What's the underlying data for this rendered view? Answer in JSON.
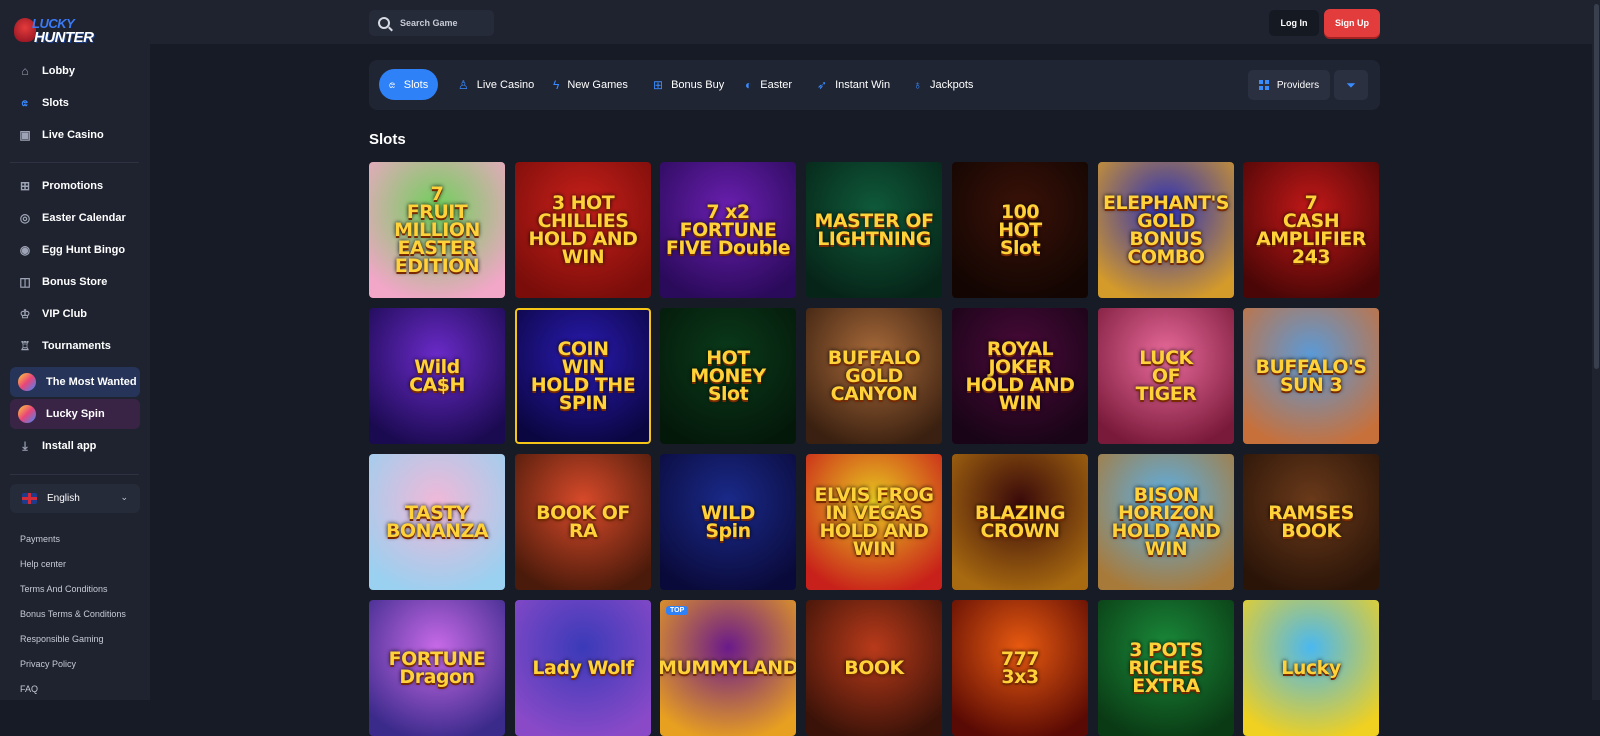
{
  "brand": {
    "line1": "LUCKY",
    "line2": "HUNTER"
  },
  "sidebar": {
    "main": [
      {
        "label": "Lobby",
        "icon": "home-icon"
      },
      {
        "label": "Slots",
        "icon": "cherries-icon"
      },
      {
        "label": "Live Casino",
        "icon": "cards-icon"
      }
    ],
    "secondary": [
      {
        "label": "Promotions",
        "icon": "gift-icon"
      },
      {
        "label": "Easter Calendar",
        "icon": "calendar-icon"
      },
      {
        "label": "Egg Hunt Bingo",
        "icon": "bingo-icon"
      },
      {
        "label": "Bonus Store",
        "icon": "bag-icon"
      },
      {
        "label": "VIP Club",
        "icon": "crown-icon"
      },
      {
        "label": "Tournaments",
        "icon": "trophy-icon"
      }
    ],
    "featured": [
      {
        "label": "The Most Wanted"
      },
      {
        "label": "Lucky Spin"
      }
    ],
    "install": "Install app",
    "language": "English",
    "footer_links": [
      "Payments",
      "Help center",
      "Terms And Conditions",
      "Bonus Terms & Conditions",
      "Responsible Gaming",
      "Privacy Policy",
      "FAQ"
    ]
  },
  "header": {
    "search_placeholder": "Search Game",
    "login": "Log In",
    "signup": "Sign Up"
  },
  "categories": [
    {
      "label": "Slots",
      "icon": "cherries-icon"
    },
    {
      "label": "Live Casino",
      "icon": "dealer-icon"
    },
    {
      "label": "New Games",
      "icon": "bolt-icon"
    },
    {
      "label": "Bonus Buy",
      "icon": "gift-icon"
    },
    {
      "label": "Easter",
      "icon": "egg-icon"
    },
    {
      "label": "Instant Win",
      "icon": "rocket-icon"
    },
    {
      "label": "Jackpots",
      "icon": "moneybag-icon"
    }
  ],
  "providers_label": "Providers",
  "section_title": "Slots",
  "games": [
    {
      "title": "7\nFRUIT\nMILLION\nEASTER EDITION"
    },
    {
      "title": "3 HOT\nCHILLIES\nHOLD AND WIN"
    },
    {
      "title": "7 x2\nFORTUNE\nFIVE Double"
    },
    {
      "title": "MASTER OF\nLIGHTNING"
    },
    {
      "title": "100\nHOT\nSlot"
    },
    {
      "title": "ELEPHANT'S\nGOLD\nBONUS COMBO"
    },
    {
      "title": "7\nCASH\nAMPLIFIER 243"
    },
    {
      "title": "Wild\nCA$H"
    },
    {
      "title": "COIN\nWIN\nHOLD THE SPIN",
      "selected": true
    },
    {
      "title": "HOT\nMONEY\nSlot"
    },
    {
      "title": "BUFFALO\nGOLD CANYON"
    },
    {
      "title": "ROYAL\nJOKER\nHOLD AND WIN"
    },
    {
      "title": "LUCK\nOF\nTIGER"
    },
    {
      "title": "BUFFALO'S\nSUN 3"
    },
    {
      "title": "TASTY\nBONANZA"
    },
    {
      "title": "BOOK OF RA"
    },
    {
      "title": "WILD\nSpin"
    },
    {
      "title": "ELVIS FROG\nIN VEGAS\nHOLD AND WIN"
    },
    {
      "title": "BLAZING\nCROWN"
    },
    {
      "title": "BISON HORIZON\nHOLD AND WIN"
    },
    {
      "title": "RAMSES\nBOOK"
    },
    {
      "title": "FORTUNE\nDragon"
    },
    {
      "title": "Lady Wolf"
    },
    {
      "title": "MUMMYLAND",
      "badge": "TOP"
    },
    {
      "title": "BOOK"
    },
    {
      "title": "777\n3x3"
    },
    {
      "title": "3 POTS\nRICHES EXTRA"
    },
    {
      "title": "Lucky"
    }
  ],
  "tile_colors": [
    [
      "#6fcf5a",
      "#f2a6c8"
    ],
    [
      "#c8201a",
      "#7a0d0a"
    ],
    [
      "#6a1fb0",
      "#2a0a5a"
    ],
    [
      "#0f5a3a",
      "#062418"
    ],
    [
      "#3a1208",
      "#120502"
    ],
    [
      "#2a2fb8",
      "#d49a2a"
    ],
    [
      "#c21818",
      "#4a0606"
    ],
    [
      "#6a2ac8",
      "#1a0a50"
    ],
    [
      "#2a1ab0",
      "#0a0640"
    ],
    [
      "#0a3a1a",
      "#04180a"
    ],
    [
      "#a86a3a",
      "#3a2010"
    ],
    [
      "#4a0a3a",
      "#180416"
    ],
    [
      "#e86a9a",
      "#7a1a3a"
    ],
    [
      "#5a9ad8",
      "#c8703a"
    ],
    [
      "#f0b8d8",
      "#9ad0f0"
    ],
    [
      "#d84a2a",
      "#4a1a0a"
    ],
    [
      "#1a2a8a",
      "#0a0a3a"
    ],
    [
      "#e8c820",
      "#c8201a"
    ],
    [
      "#3a0a0a",
      "#a86a10"
    ],
    [
      "#5ab0e8",
      "#a87a3a"
    ],
    [
      "#6a3a1a",
      "#2a1408"
    ],
    [
      "#c86ae8",
      "#3a2a8a"
    ],
    [
      "#3a3ab8",
      "#8a4ac8"
    ],
    [
      "#6a1a8a",
      "#e8a020"
    ],
    [
      "#b83a1a",
      "#3a1208"
    ],
    [
      "#e85a10",
      "#5a0a04"
    ],
    [
      "#1a8a3a",
      "#0a3a14"
    ],
    [
      "#4ab8f0",
      "#f0d020"
    ]
  ]
}
